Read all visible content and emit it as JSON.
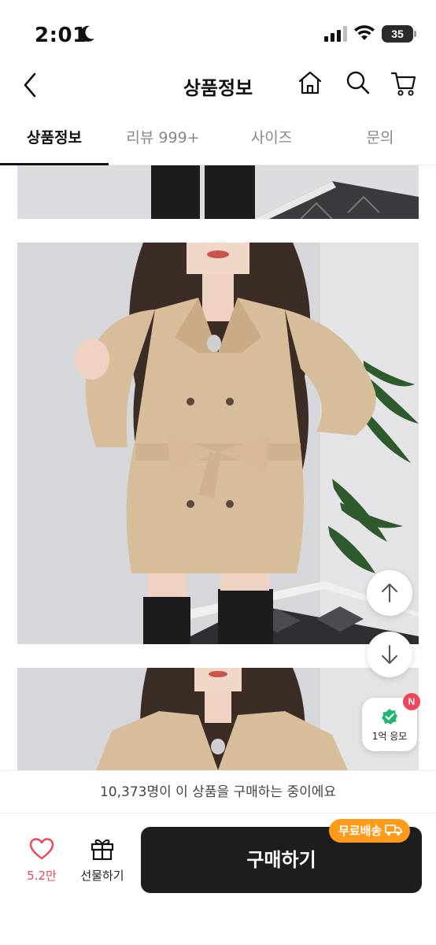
{
  "status_bar": {
    "time": "2:01",
    "battery": "35"
  },
  "header": {
    "title": "상품정보"
  },
  "tabs": [
    {
      "label": "상품정보",
      "active": true
    },
    {
      "label": "리뷰 999+",
      "active": false
    },
    {
      "label": "사이즈",
      "active": false
    },
    {
      "label": "문의",
      "active": false
    }
  ],
  "event": {
    "label": "1억 응모",
    "badge": "N"
  },
  "buying_notice": "10,373명이 이 상품을 구매하는 중이에요",
  "bottom_bar": {
    "like_count": "5.2만",
    "gift_label": "선물하기",
    "buy_label": "구매하기",
    "shipping_badge": "무료배송"
  },
  "colors": {
    "accent": "#f0465a",
    "shipping": "#ff9a1a",
    "buy_button": "#1d1d1f",
    "coat": "#d8bd9a"
  },
  "icons": [
    "moon-icon",
    "signal-icon",
    "wifi-icon",
    "back-icon",
    "home-icon",
    "search-icon",
    "cart-icon",
    "arrow-up-icon",
    "arrow-down-icon",
    "check-badge-icon",
    "heart-icon",
    "gift-icon",
    "truck-icon"
  ]
}
